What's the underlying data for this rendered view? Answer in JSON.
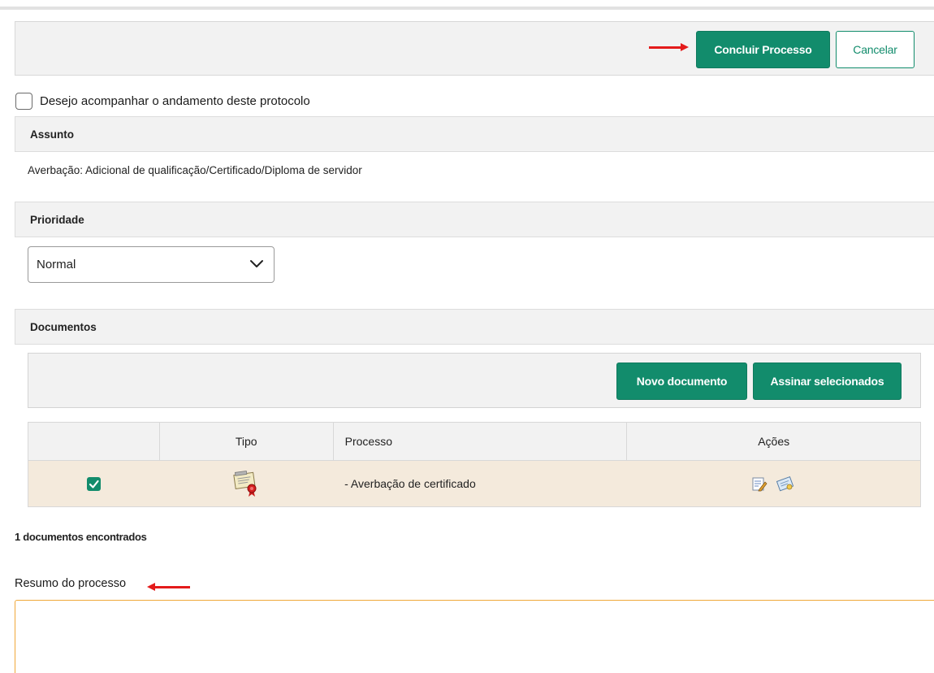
{
  "actions": {
    "conclude_label": "Concluir Processo",
    "cancel_label": "Cancelar"
  },
  "follow": {
    "label": "Desejo acompanhar o andamento deste protocolo",
    "checked": false
  },
  "subject": {
    "header": "Assunto",
    "value": "Averbação: Adicional de qualificação/Certificado/Diploma de servidor"
  },
  "priority": {
    "header": "Prioridade",
    "selected": "Normal"
  },
  "documents": {
    "header": "Documentos",
    "new_label": "Novo documento",
    "sign_label": "Assinar selecionados",
    "columns": [
      "",
      "Tipo",
      "Processo",
      "Ações"
    ],
    "rows": [
      {
        "checked": true,
        "type_icon": "certificate-icon",
        "process": "- Averbação de certificado",
        "actions": [
          "edit-document-icon",
          "view-document-icon"
        ]
      }
    ],
    "found_text": "1 documentos encontrados"
  },
  "summary": {
    "label": "Resumo do processo",
    "value": ""
  },
  "colors": {
    "primary": "#128c6c",
    "row_highlight": "#f4eadc",
    "arrow": "#e41b1b",
    "textarea_border": "#f0a83a"
  }
}
